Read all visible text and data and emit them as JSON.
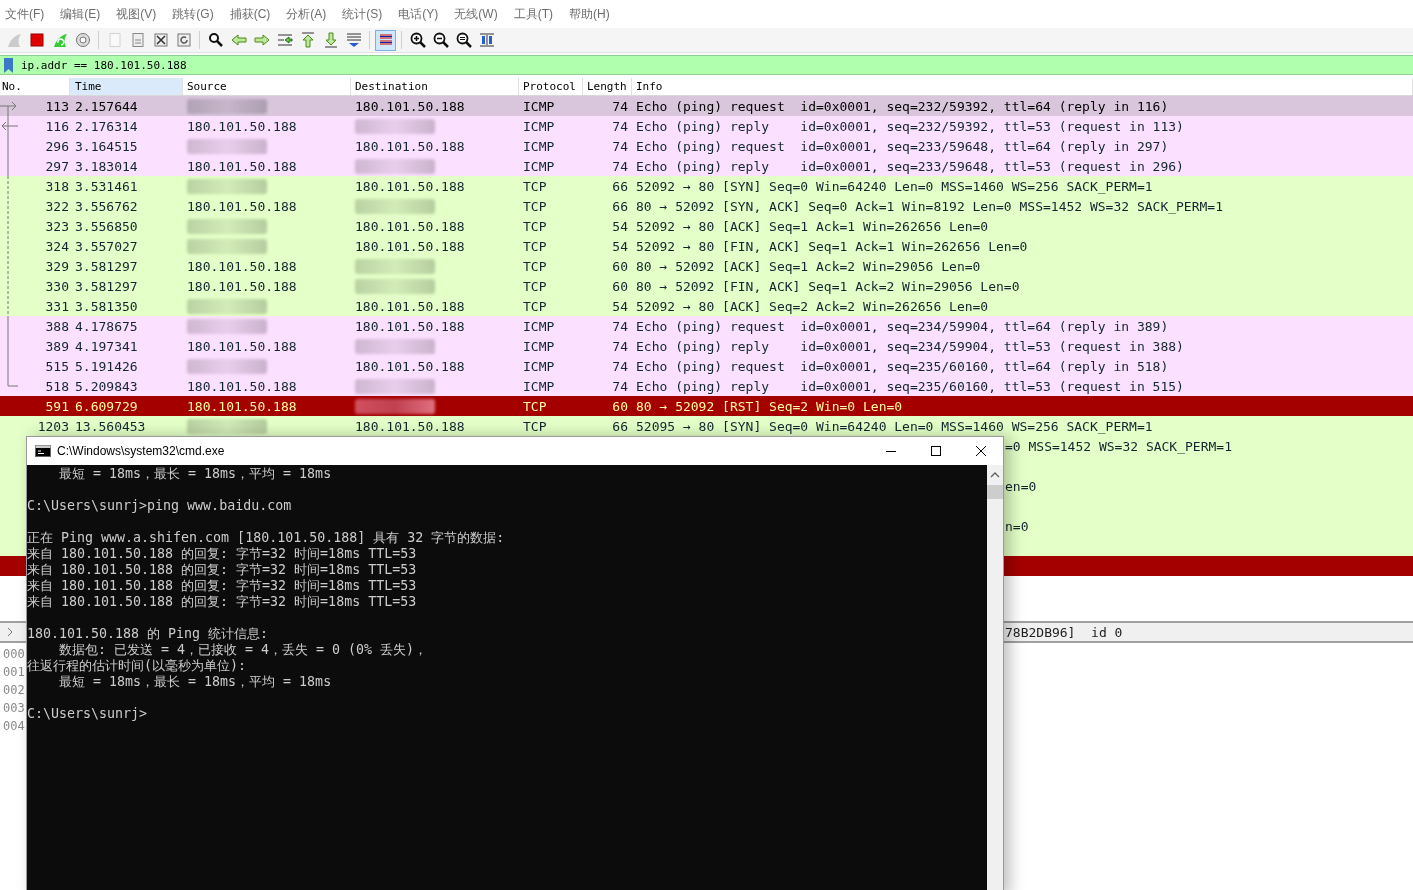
{
  "menu": [
    "文件(F)",
    "编辑(E)",
    "视图(V)",
    "跳转(G)",
    "捕获(C)",
    "分析(A)",
    "统计(S)",
    "电话(Y)",
    "无线(W)",
    "工具(T)",
    "帮助(H)"
  ],
  "toolbar": {
    "groups": [
      [
        {
          "kind": "shark-fin",
          "disabled": true
        },
        {
          "kind": "stop",
          "disabled": false
        },
        {
          "kind": "restart",
          "disabled": false
        },
        {
          "kind": "options",
          "disabled": false
        }
      ],
      [
        {
          "kind": "open",
          "disabled": true
        },
        {
          "kind": "save",
          "disabled": false
        },
        {
          "kind": "close",
          "disabled": false
        },
        {
          "kind": "reload",
          "disabled": false
        }
      ],
      [
        {
          "kind": "find",
          "disabled": false
        },
        {
          "kind": "back",
          "disabled": false
        },
        {
          "kind": "forward",
          "disabled": false
        },
        {
          "kind": "goto",
          "disabled": false
        },
        {
          "kind": "first",
          "disabled": false
        },
        {
          "kind": "last",
          "disabled": false
        },
        {
          "kind": "autoscroll",
          "disabled": false
        }
      ],
      [
        {
          "kind": "colorize",
          "disabled": false,
          "selected": true
        }
      ],
      [
        {
          "kind": "zoom-in",
          "disabled": false
        },
        {
          "kind": "zoom-out",
          "disabled": false
        },
        {
          "kind": "zoom-reset",
          "disabled": false
        },
        {
          "kind": "resize-columns",
          "disabled": false
        }
      ]
    ]
  },
  "filter": {
    "value": "ip.addr == 180.101.50.188"
  },
  "packet_list": {
    "columns": [
      {
        "label": "No.",
        "selected": false
      },
      {
        "label": "Time",
        "selected": true
      },
      {
        "label": "Source",
        "selected": false
      },
      {
        "label": "Destination",
        "selected": false
      },
      {
        "label": "Protocol",
        "selected": false
      },
      {
        "label": "Length",
        "selected": false
      },
      {
        "label": "Info",
        "selected": false
      }
    ],
    "rows": [
      {
        "kind": "icmp",
        "selected": true,
        "no": "113",
        "time": "2.157644",
        "source_blurred": true,
        "destination": "180.101.50.188",
        "protocol": "ICMP",
        "length": "74",
        "info": "Echo (ping) request  id=0x0001, seq=232/59392, ttl=64 (reply in 116)"
      },
      {
        "kind": "icmp",
        "selected": false,
        "no": "116",
        "time": "2.176314",
        "source": "180.101.50.188",
        "destination_blurred": true,
        "protocol": "ICMP",
        "length": "74",
        "info": "Echo (ping) reply    id=0x0001, seq=232/59392, ttl=53 (request in 113)"
      },
      {
        "kind": "icmp",
        "selected": false,
        "no": "296",
        "time": "3.164515",
        "source_blurred": true,
        "destination": "180.101.50.188",
        "protocol": "ICMP",
        "length": "74",
        "info": "Echo (ping) request  id=0x0001, seq=233/59648, ttl=64 (reply in 297)"
      },
      {
        "kind": "icmp",
        "selected": false,
        "no": "297",
        "time": "3.183014",
        "source": "180.101.50.188",
        "destination_blurred": true,
        "protocol": "ICMP",
        "length": "74",
        "info": "Echo (ping) reply    id=0x0001, seq=233/59648, ttl=53 (request in 296)"
      },
      {
        "kind": "tcp",
        "selected": false,
        "no": "318",
        "time": "3.531461",
        "source_blurred": true,
        "destination": "180.101.50.188",
        "protocol": "TCP",
        "length": "66",
        "info": "52092 → 80 [SYN] Seq=0 Win=64240 Len=0 MSS=1460 WS=256 SACK_PERM=1"
      },
      {
        "kind": "tcp",
        "selected": false,
        "no": "322",
        "time": "3.556762",
        "source": "180.101.50.188",
        "destination_blurred": true,
        "protocol": "TCP",
        "length": "66",
        "info": "80 → 52092 [SYN, ACK] Seq=0 Ack=1 Win=8192 Len=0 MSS=1452 WS=32 SACK_PERM=1"
      },
      {
        "kind": "tcp",
        "selected": false,
        "no": "323",
        "time": "3.556850",
        "source_blurred": true,
        "destination": "180.101.50.188",
        "protocol": "TCP",
        "length": "54",
        "info": "52092 → 80 [ACK] Seq=1 Ack=1 Win=262656 Len=0"
      },
      {
        "kind": "tcp",
        "selected": false,
        "no": "324",
        "time": "3.557027",
        "source_blurred": true,
        "destination": "180.101.50.188",
        "protocol": "TCP",
        "length": "54",
        "info": "52092 → 80 [FIN, ACK] Seq=1 Ack=1 Win=262656 Len=0"
      },
      {
        "kind": "tcp",
        "selected": false,
        "no": "329",
        "time": "3.581297",
        "source": "180.101.50.188",
        "destination_blurred": true,
        "protocol": "TCP",
        "length": "60",
        "info": "80 → 52092 [ACK] Seq=1 Ack=2 Win=29056 Len=0"
      },
      {
        "kind": "tcp",
        "selected": false,
        "no": "330",
        "time": "3.581297",
        "source": "180.101.50.188",
        "destination_blurred": true,
        "protocol": "TCP",
        "length": "60",
        "info": "80 → 52092 [FIN, ACK] Seq=1 Ack=2 Win=29056 Len=0"
      },
      {
        "kind": "tcp",
        "selected": false,
        "no": "331",
        "time": "3.581350",
        "source_blurred": true,
        "destination": "180.101.50.188",
        "protocol": "TCP",
        "length": "54",
        "info": "52092 → 80 [ACK] Seq=2 Ack=2 Win=262656 Len=0"
      },
      {
        "kind": "icmp",
        "selected": false,
        "no": "388",
        "time": "4.178675",
        "source_blurred": true,
        "destination": "180.101.50.188",
        "protocol": "ICMP",
        "length": "74",
        "info": "Echo (ping) request  id=0x0001, seq=234/59904, ttl=64 (reply in 389)"
      },
      {
        "kind": "icmp",
        "selected": false,
        "no": "389",
        "time": "4.197341",
        "source": "180.101.50.188",
        "destination_blurred": true,
        "protocol": "ICMP",
        "length": "74",
        "info": "Echo (ping) reply    id=0x0001, seq=234/59904, ttl=53 (request in 388)"
      },
      {
        "kind": "icmp",
        "selected": false,
        "no": "515",
        "time": "5.191426",
        "source_blurred": true,
        "destination": "180.101.50.188",
        "protocol": "ICMP",
        "length": "74",
        "info": "Echo (ping) request  id=0x0001, seq=235/60160, ttl=64 (reply in 518)"
      },
      {
        "kind": "icmp",
        "selected": false,
        "no": "518",
        "time": "5.209843",
        "source": "180.101.50.188",
        "destination_blurred": true,
        "protocol": "ICMP",
        "length": "74",
        "info": "Echo (ping) reply    id=0x0001, seq=235/60160, ttl=53 (request in 515)"
      },
      {
        "kind": "rst",
        "selected": false,
        "no": "591",
        "time": "6.609729",
        "source": "180.101.50.188",
        "destination_blurred": true,
        "protocol": "TCP",
        "length": "60",
        "info": "80 → 52092 [RST] Seq=2 Win=0 Len=0"
      },
      {
        "kind": "tcp",
        "selected": false,
        "no": "1203",
        "time": "13.560453",
        "source_blurred": true,
        "destination": "180.101.50.188",
        "protocol": "TCP",
        "length": "66",
        "info": "52095 → 80 [SYN] Seq=0 Win=64240 Len=0 MSS=1460 WS=256 SACK_PERM=1"
      },
      {
        "kind": "tcp",
        "selected": false,
        "info_visible": "=0 MSS=1452 WS=32 SACK_PERM=1"
      },
      {
        "kind": "tcp",
        "selected": false
      },
      {
        "kind": "tcp",
        "selected": false,
        "info_visible": "en=0"
      },
      {
        "kind": "tcp",
        "selected": false
      },
      {
        "kind": "tcp",
        "selected": false,
        "info_visible": "n=0"
      },
      {
        "kind": "tcp",
        "selected": false
      },
      {
        "kind": "rst",
        "selected": false
      }
    ]
  },
  "details": {
    "visible_text": "78B2DB96]  id 0"
  },
  "bytes": {
    "offsets": [
      "000",
      "001",
      "002",
      "003",
      "004"
    ]
  },
  "cmd_window": {
    "title": "C:\\Windows\\system32\\cmd.exe",
    "blocks": [
      [
        "    最短 = 18ms，最长 = 18ms，平均 = 18ms"
      ],
      [
        "C:\\Users\\sunrj>ping www.baidu.com"
      ],
      [
        "正在 Ping www.a.shifen.com [180.101.50.188] 具有 32 字节的数据:",
        "来自 180.101.50.188 的回复: 字节=32 时间=18ms TTL=53",
        "来自 180.101.50.188 的回复: 字节=32 时间=18ms TTL=53",
        "来自 180.101.50.188 的回复: 字节=32 时间=18ms TTL=53",
        "来自 180.101.50.188 的回复: 字节=32 时间=18ms TTL=53"
      ],
      [
        "180.101.50.188 的 Ping 统计信息:",
        "    数据包: 已发送 = 4，已接收 = 4，丢失 = 0 (0% 丢失)，",
        "往返行程的估计时间(以毫秒为单位):",
        "    最短 = 18ms，最长 = 18ms，平均 = 18ms"
      ],
      [
        "C:\\Users\\sunrj>"
      ]
    ]
  }
}
